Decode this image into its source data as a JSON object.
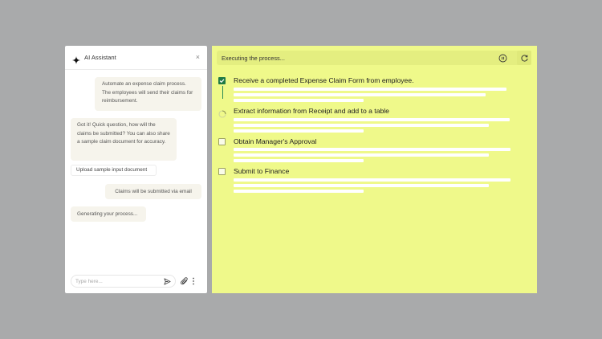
{
  "assistant": {
    "title": "AI Assistant",
    "close_glyph": "×",
    "messages": {
      "user_request": "Automate an expense claim process. The employees will send their claims for reimbursement.",
      "ai_question": "Got it! Quick question, how will the claims be submitted? You can also share a sample claim document for accuracy.",
      "upload_button": "Upload sample input document",
      "user_reply": "Claims will be submitted via email",
      "ai_status": "Generating your process..."
    },
    "composer": {
      "placeholder": "Type here..."
    },
    "icons": [
      "sparkle-icon",
      "close-icon",
      "send-icon",
      "paperclip-icon",
      "more-vertical-icon"
    ]
  },
  "process": {
    "status": "Executing the process...",
    "icons": [
      "pause-icon",
      "refresh-icon"
    ],
    "steps": [
      {
        "title": "Receive a completed Expense Claim Form from employee.",
        "state": "done"
      },
      {
        "title": "Extract information from Receipt and add to a table",
        "state": "in-progress"
      },
      {
        "title": "Obtain Manager's Approval",
        "state": "pending"
      },
      {
        "title": "Submit to Finance",
        "state": "pending"
      }
    ]
  },
  "colors": {
    "background": "#a9aaab",
    "process_panel": "#eff98a",
    "check_green": "#1f7a45",
    "bubble": "#f6f4ec"
  }
}
